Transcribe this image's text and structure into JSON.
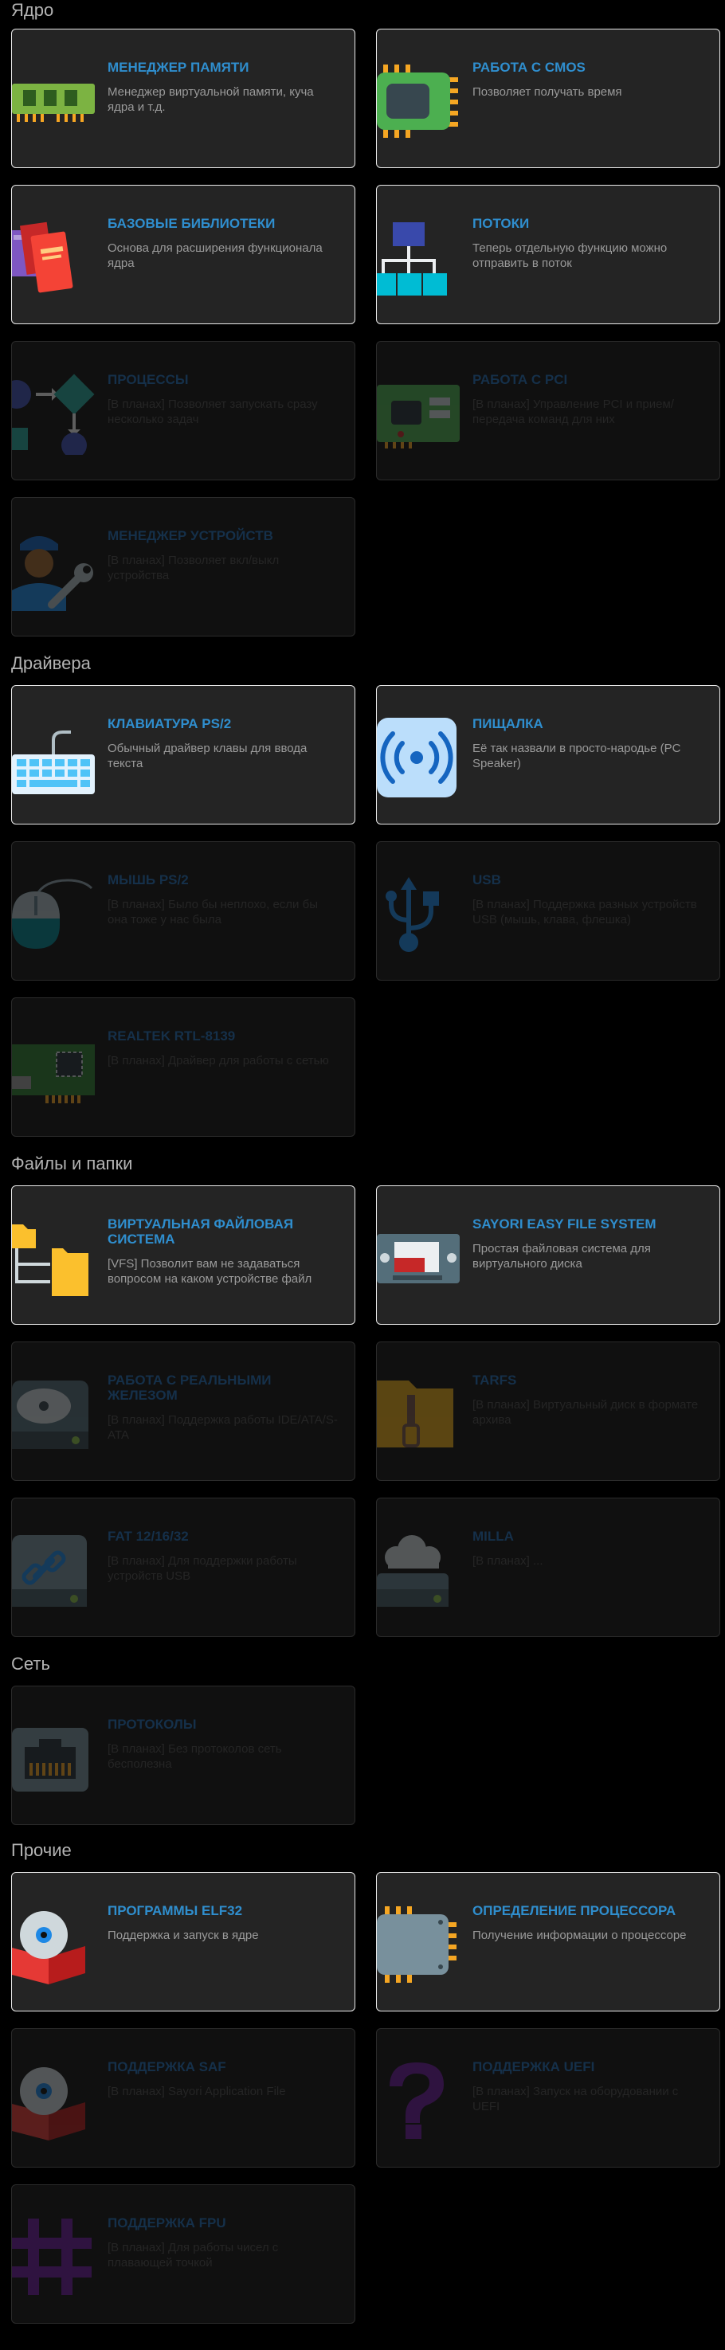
{
  "sections": [
    {
      "title": "Ядро"
    },
    {
      "title": "Драйвера"
    },
    {
      "title": "Файлы и папки"
    },
    {
      "title": "Сеть"
    },
    {
      "title": "Прочие"
    }
  ],
  "cards": [
    {
      "title": "Менеджер памяти",
      "desc": "Менеджер виртуальной памяти, куча ядра и т.д.",
      "icon": "ram-icon",
      "active": true
    },
    {
      "title": "Работа с CMOS",
      "desc": "Позволяет получать время",
      "icon": "chip-icon",
      "active": true
    },
    {
      "title": "Базовые библиотеки",
      "desc": "Основа для расширения функционала ядра",
      "icon": "books-icon",
      "active": true
    },
    {
      "title": "Потоки",
      "desc": "Теперь отдельную функцию можно отправить в поток",
      "icon": "hierarchy-icon",
      "active": true
    },
    {
      "title": "Процессы",
      "desc": "[В планах] Позволяет запускать сразу несколько задач",
      "icon": "flowchart-icon",
      "active": false
    },
    {
      "title": "Работа с PCI",
      "desc": "[В планах] Управление PCI и прием/передача команд для них",
      "icon": "pci-card-icon",
      "active": false
    },
    {
      "title": "Менеджер устройств",
      "desc": "[В планах] Позволяет вкл/выкл устройства",
      "icon": "mechanic-icon",
      "active": false
    },
    {
      "title": "Клавиатура PS/2",
      "desc": "Обычный драйвер клавы для ввода текста",
      "icon": "keyboard-icon",
      "active": true
    },
    {
      "title": "Пищалка",
      "desc": "Её так назвали в просто-народье (PC Speaker)",
      "icon": "speaker-icon",
      "active": true
    },
    {
      "title": "Мышь PS/2",
      "desc": "[В планах] Было бы неплохо, если бы она тоже у нас была",
      "icon": "mouse-icon",
      "active": false
    },
    {
      "title": "USB",
      "desc": "[В планах] Поддержка разных устройств USB (мышь, клава, флешка)",
      "icon": "usb-icon",
      "active": false
    },
    {
      "title": "Realtek RTL-8139",
      "desc": "[В планах] Драйвер для работы с сетью",
      "icon": "network-card-icon",
      "active": false
    },
    {
      "title": "Виртуальная файловая система",
      "desc": "[VFS] Позволит вам не задаваться вопросом на каком устройстве файл",
      "icon": "folders-icon",
      "active": true
    },
    {
      "title": "Sayori Easy File System",
      "desc": "Простая файловая система для виртуального диска",
      "icon": "cassette-icon",
      "active": true
    },
    {
      "title": "Работа с реальными железом",
      "desc": "[В планах] Поддержка работы IDE/ATA/S-ATA",
      "icon": "hdd-icon",
      "active": false
    },
    {
      "title": "TarFS",
      "desc": "[В планах] Виртуальный диск в формате архива",
      "icon": "archive-icon",
      "active": false
    },
    {
      "title": "FAT 12/16/32",
      "desc": "[В планах] Для поддержки работы устройств USB",
      "icon": "drive-link-icon",
      "active": false
    },
    {
      "title": "Milla",
      "desc": "[В планах] ...",
      "icon": "cloud-drive-icon",
      "active": false
    },
    {
      "title": "Протоколы",
      "desc": "[В планах] Без протоколов сеть бесполезна",
      "icon": "ethernet-icon",
      "active": false
    },
    {
      "title": "Программы ELF32",
      "desc": "Поддержка и запуск в ядре",
      "icon": "disc-box-icon",
      "active": true
    },
    {
      "title": "Определение процессора",
      "desc": "Получение информации о процессоре",
      "icon": "cpu-icon",
      "active": true
    },
    {
      "title": "Поддержка SAF",
      "desc": "[В планах] Sayori Application File",
      "icon": "disc-box-icon",
      "active": false
    },
    {
      "title": "Поддержка UEFI",
      "desc": "[В планах] Запуск на оборудовании с UEFI",
      "icon": "question-icon",
      "active": false
    },
    {
      "title": "Поддержка FPU",
      "desc": "[В планах] Для работы чисел с плавающей точкой",
      "icon": "hash-icon",
      "active": false
    }
  ]
}
